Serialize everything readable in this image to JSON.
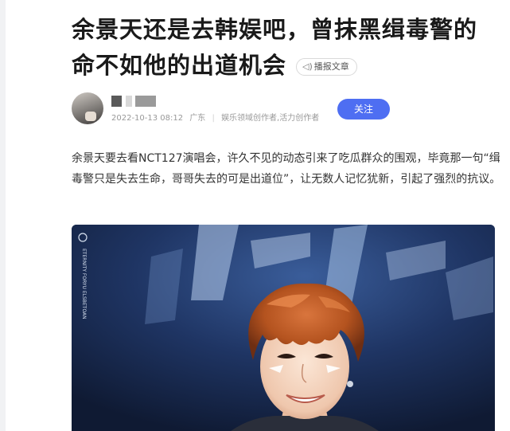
{
  "article": {
    "title_line1": "余景天还是去韩娱吧，曾抹黑缉毒警的",
    "title_line2": "命不如他的出道机会",
    "broadcast_label": "播报文章"
  },
  "author": {
    "date": "2022-10-13 08:12",
    "region": "广东",
    "credentials": "娱乐领域创作者,活力创作者",
    "follow_label": "关注"
  },
  "body": {
    "paragraph": "余景天要去看NCT127演唱会，许久不见的动态引来了吃瓜群众的围观，毕竟那一句“缉毒警只是失去生命，哥哥失去的可是出道位”，让无数人记忆犹新，引起了强烈的抗议。"
  },
  "photo": {
    "watermark": "ETERNITY FORYU ELSBETOAN"
  },
  "colors": {
    "accent": "#4e6ef2",
    "title": "#1a1a1a",
    "meta": "#999999",
    "body": "#333333"
  },
  "icons": {
    "broadcast": "speaker-icon"
  }
}
